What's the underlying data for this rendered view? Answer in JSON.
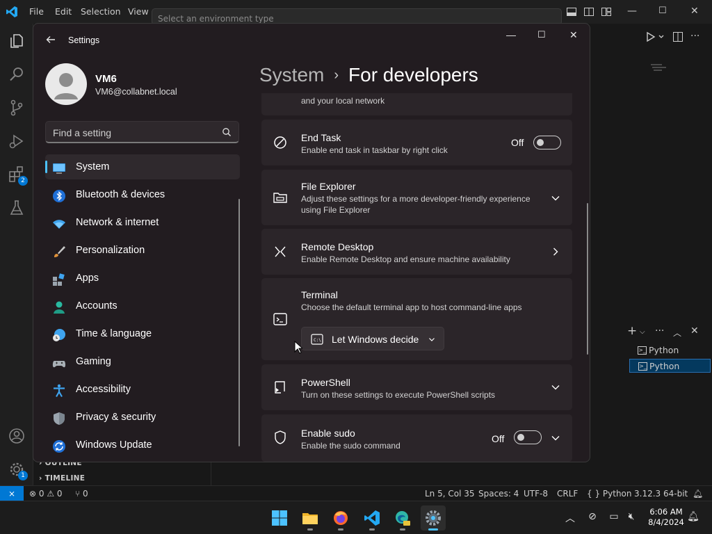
{
  "vscode": {
    "menu": [
      "File",
      "Edit",
      "Selection",
      "View"
    ],
    "command_center_text": "Select an environment type",
    "activity_badges": {
      "extensions": "2",
      "manage": "1"
    },
    "sections": {
      "outline": "OUTLINE",
      "timeline": "TIMELINE"
    },
    "terminal_items": [
      "Python",
      "Python"
    ],
    "status": {
      "errors": "0",
      "warnings": "0",
      "ports": "0",
      "position": "Ln 5, Col 35",
      "spaces": "Spaces: 4",
      "encoding": "UTF-8",
      "eol": "CRLF",
      "language": "Python",
      "interpreter": "3.12.3 64-bit"
    }
  },
  "settings": {
    "window_title": "Settings",
    "user": {
      "name": "VM6",
      "email": "VM6@collabnet.local"
    },
    "search_placeholder": "Find a setting",
    "nav": [
      {
        "label": "System",
        "icon": "system-icon",
        "selected": true
      },
      {
        "label": "Bluetooth & devices",
        "icon": "bluetooth-icon"
      },
      {
        "label": "Network & internet",
        "icon": "wifi-icon"
      },
      {
        "label": "Personalization",
        "icon": "brush-icon"
      },
      {
        "label": "Apps",
        "icon": "apps-icon"
      },
      {
        "label": "Accounts",
        "icon": "accounts-icon"
      },
      {
        "label": "Time & language",
        "icon": "globe-clock-icon"
      },
      {
        "label": "Gaming",
        "icon": "gamepad-icon"
      },
      {
        "label": "Accessibility",
        "icon": "accessibility-icon"
      },
      {
        "label": "Privacy & security",
        "icon": "shield-icon"
      },
      {
        "label": "Windows Update",
        "icon": "update-icon"
      }
    ],
    "breadcrumb": {
      "parent": "System",
      "current": "For developers"
    },
    "cards": {
      "partial_desc": "and your local network",
      "end_task": {
        "title": "End Task",
        "desc": "Enable end task in taskbar by right click",
        "state": "Off"
      },
      "file_explorer": {
        "title": "File Explorer",
        "desc": "Adjust these settings for a more developer-friendly experience using File Explorer"
      },
      "remote_desktop": {
        "title": "Remote Desktop",
        "desc": "Enable Remote Desktop and ensure machine availability"
      },
      "terminal": {
        "title": "Terminal",
        "desc": "Choose the default terminal app to host command-line apps",
        "dropdown_value": "Let Windows decide"
      },
      "powershell": {
        "title": "PowerShell",
        "desc": "Turn on these settings to execute PowerShell scripts"
      },
      "sudo": {
        "title": "Enable sudo",
        "desc": "Enable the sudo command",
        "state": "Off"
      }
    }
  },
  "taskbar": {
    "apps": [
      "start-icon",
      "file-explorer-icon",
      "firefox-icon",
      "vscode-icon",
      "edge-beta-icon",
      "settings-icon"
    ],
    "clock": {
      "time": "6:06 AM",
      "date": "8/4/2024"
    }
  },
  "colors": {
    "accent": "#4cc2ff",
    "vscode_blue": "#0078d4",
    "settings_bg": "#221c20",
    "card_bg": "#2b2529"
  }
}
